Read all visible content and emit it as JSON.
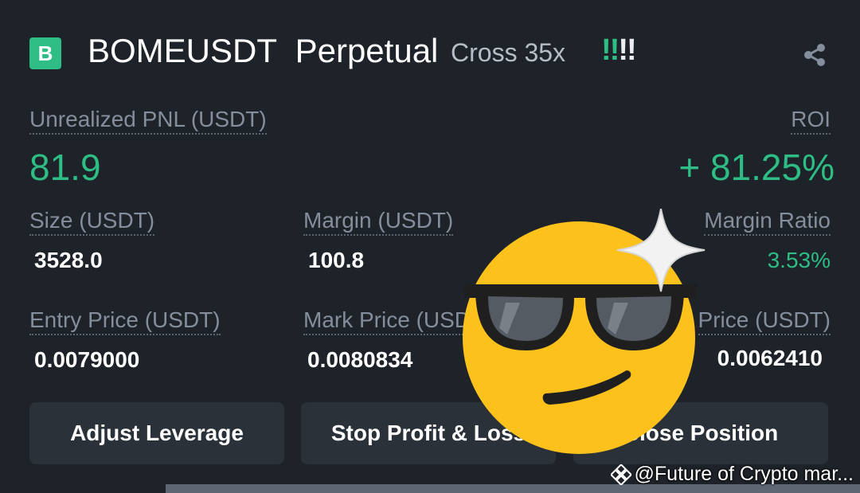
{
  "header": {
    "badge": "B",
    "symbol": "BOMEUSDT  Perpetual",
    "mode": "Cross 35x",
    "alert_green": "!!",
    "alert_white": "!!",
    "share_icon": "share-icon"
  },
  "stats": {
    "unrealized_pnl_label": "Unrealized PNL (USDT)",
    "unrealized_pnl_value": "81.9",
    "roi_label": "ROI",
    "roi_value": "+ 81.25%",
    "size_label": "Size (USDT)",
    "size_value": "3528.0",
    "margin_label": "Margin (USDT)",
    "margin_value": "100.8",
    "margin_ratio_label": "Margin Ratio",
    "margin_ratio_value": "3.53%",
    "entry_price_label": "Entry Price (USDT)",
    "entry_price_value": "0.0079000",
    "mark_price_label": "Mark Price (USDT)",
    "mark_price_value": "0.0080834",
    "liq_price_label": "Price (USDT)",
    "liq_price_value": "0.0062410"
  },
  "buttons": {
    "adjust_leverage": "Adjust Leverage",
    "stop_profit_loss": "Stop Profit & Loss",
    "close_position": "Close Position"
  },
  "watermark": "@Future of Crypto mar...",
  "colors": {
    "background": "#1e2329",
    "positive": "#2ebd85",
    "button_bg": "#2b3139",
    "muted_text": "#848e9c"
  }
}
